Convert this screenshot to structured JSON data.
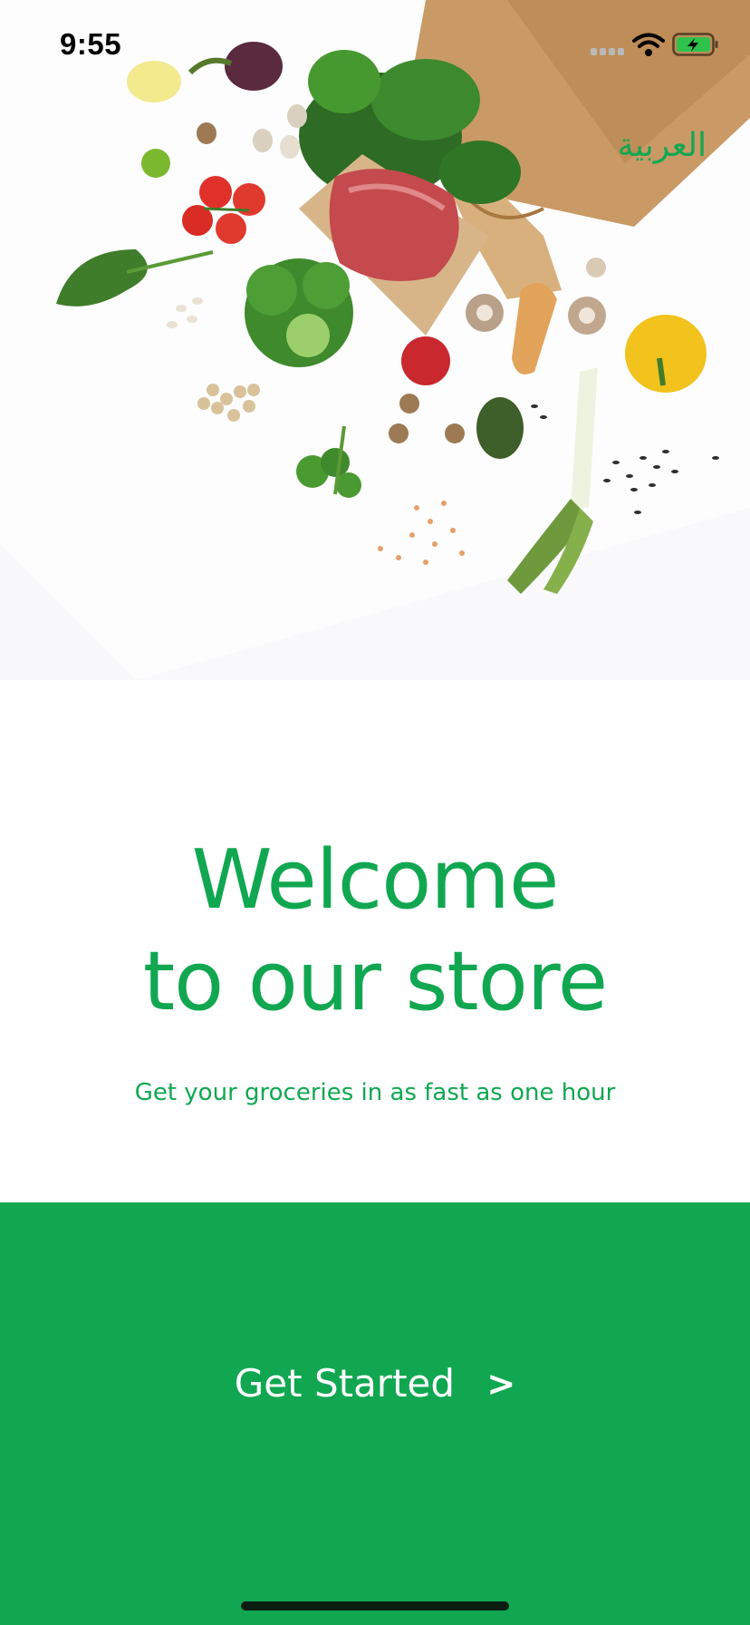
{
  "status_bar": {
    "time": "9:55"
  },
  "header": {
    "language_label": "العربية"
  },
  "welcome": {
    "title_line1": "Welcome",
    "title_line2": "to our store",
    "subtitle": "Get your groceries in as fast as one hour"
  },
  "cta": {
    "label": "Get Started",
    "chevron": ">"
  },
  "icons": {
    "signal": "cellular-signal-icon",
    "wifi": "wifi-icon",
    "battery": "battery-charging-icon",
    "cta_arrow": "chevron-right-icon"
  },
  "colors": {
    "brand_green": "#11a751",
    "battery_green": "#2fc24d",
    "text_black": "#000000",
    "background": "#ffffff"
  }
}
